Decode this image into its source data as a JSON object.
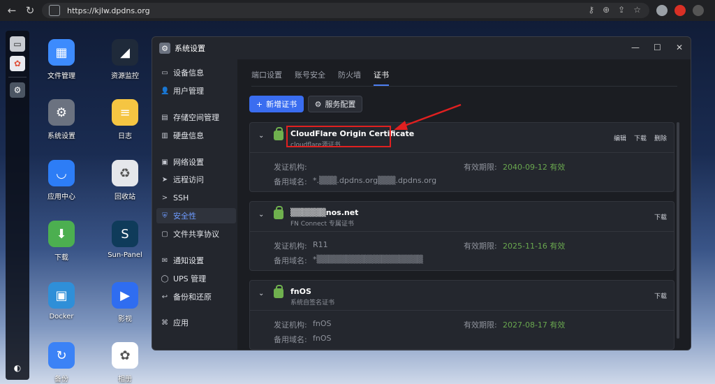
{
  "browser": {
    "url": "https://kjlw.dpdns.org"
  },
  "desktop": {
    "icons": [
      {
        "label": "文件管理",
        "color": "#3d8bfd",
        "glyph": "▦"
      },
      {
        "label": "资源监控",
        "color": "#1f2a3a",
        "glyph": "◢"
      },
      {
        "label": "系统设置",
        "color": "#6b7280",
        "glyph": "⚙"
      },
      {
        "label": "日志",
        "color": "#f5c542",
        "glyph": "≡"
      },
      {
        "label": "应用中心",
        "color": "#2d7df6",
        "glyph": "◡"
      },
      {
        "label": "回收站",
        "color": "#e5e7eb",
        "glyph": "♻"
      },
      {
        "label": "下载",
        "color": "#4caf50",
        "glyph": "⬇"
      },
      {
        "label": "Sun-Panel",
        "color": "#0f3b5a",
        "glyph": "S"
      },
      {
        "label": "Docker",
        "color": "#2f8fd8",
        "glyph": "▣"
      },
      {
        "label": "影视",
        "color": "#2f6df0",
        "glyph": "▶"
      },
      {
        "label": "备份",
        "color": "#3b82f6",
        "glyph": "↻"
      },
      {
        "label": "相册",
        "color": "#ffffff",
        "glyph": "✿"
      }
    ]
  },
  "window": {
    "title": "系统设置",
    "controls": {
      "minimize": "—",
      "maximize": "☐",
      "close": "✕"
    },
    "sidebar": [
      {
        "label": "设备信息",
        "icon": "monitor-icon",
        "glyph": "▭",
        "active": false
      },
      {
        "label": "用户管理",
        "icon": "user-icon",
        "glyph": "👤",
        "active": false
      },
      {
        "label": "存储空间管理",
        "icon": "storage-icon",
        "glyph": "▤",
        "active": false
      },
      {
        "label": "硬盘信息",
        "icon": "disk-icon",
        "glyph": "▥",
        "active": false
      },
      {
        "label": "网络设置",
        "icon": "network-icon",
        "glyph": "▣",
        "active": false
      },
      {
        "label": "远程访问",
        "icon": "send-icon",
        "glyph": "➤",
        "active": false
      },
      {
        "label": "SSH",
        "icon": "terminal-icon",
        "glyph": ">",
        "active": false
      },
      {
        "label": "安全性",
        "icon": "shield-icon",
        "glyph": "⛨",
        "active": true
      },
      {
        "label": "文件共享协议",
        "icon": "share-icon",
        "glyph": "▢",
        "active": false
      },
      {
        "label": "通知设置",
        "icon": "mail-icon",
        "glyph": "✉",
        "active": false
      },
      {
        "label": "UPS 管理",
        "icon": "ups-icon",
        "glyph": "◯",
        "active": false
      },
      {
        "label": "备份和还原",
        "icon": "backup-icon",
        "glyph": "↩",
        "active": false
      },
      {
        "label": "应用",
        "icon": "apps-icon",
        "glyph": "⌘",
        "active": false
      }
    ],
    "tabs": [
      {
        "label": "端口设置",
        "active": false
      },
      {
        "label": "账号安全",
        "active": false
      },
      {
        "label": "防火墙",
        "active": false
      },
      {
        "label": "证书",
        "active": true
      }
    ],
    "buttons": {
      "add_cert": "新增证书",
      "service_config": "服务配置"
    },
    "field_labels": {
      "issuer": "发证机构:",
      "validity": "有效期限:",
      "alt_names": "备用域名:"
    },
    "certificates": [
      {
        "name": "CloudFlare Origin Certificate",
        "subtitle": "cloudflare源证书",
        "actions": [
          "编辑",
          "下载",
          "删除"
        ],
        "issuer": "",
        "expiry": "2040-09-12 有效",
        "alt_names": "*.▒▒▒.dpdns.org▒▒▒.dpdns.org"
      },
      {
        "name": "▒▒▒▒▒▒nos.net",
        "subtitle": "FN Connect 专属证书",
        "actions": [
          "下载"
        ],
        "issuer": "R11",
        "expiry": "2025-11-16 有效",
        "alt_names": "*▒▒▒▒▒▒▒▒▒▒▒▒▒▒▒▒▒▒"
      },
      {
        "name": "fnOS",
        "subtitle": "系统自签名证书",
        "actions": [
          "下载"
        ],
        "issuer": "fnOS",
        "expiry": "2027-08-17 有效",
        "alt_names": "fnOS"
      }
    ]
  },
  "colors": {
    "accent": "#3a6df0",
    "ok": "#6aa84f",
    "highlight": "#e02020"
  }
}
